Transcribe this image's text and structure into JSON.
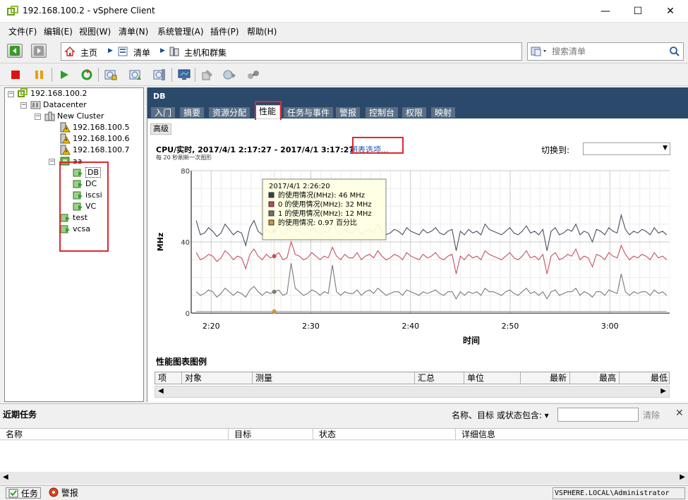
{
  "window": {
    "title": "192.168.100.2 - vSphere Client",
    "minimize_glyph": "—",
    "maximize_glyph": "☐",
    "close_glyph": "✕"
  },
  "menu": [
    "文件(F)",
    "编辑(E)",
    "视图(W)",
    "清单(N)",
    "系统管理(A)",
    "插件(P)",
    "帮助(H)"
  ],
  "breadcrumb": {
    "home": "主页",
    "inventory": "清单",
    "hosts_clusters": "主机和群集"
  },
  "search": {
    "placeholder": "搜索清单"
  },
  "tree": {
    "root": "192.168.100.2",
    "datacenter": "Datacenter",
    "cluster": "New Cluster",
    "hosts": [
      "192.168.100.5",
      "192.168.100.6",
      "192.168.100.7"
    ],
    "vapp": "aa",
    "vms": [
      "DB",
      "DC",
      "iscsi",
      "VC"
    ],
    "other_vms": [
      "test",
      "vcsa"
    ]
  },
  "object": {
    "title": "DB",
    "tabs": [
      "入门",
      "摘要",
      "资源分配",
      "性能",
      "任务与事件",
      "警报",
      "控制台",
      "权限",
      "映射"
    ],
    "active_tab": "性能",
    "subtab": "高级"
  },
  "chart_header": {
    "title": "CPU/实时, 2017/4/1 2:17:27 - 2017/4/1 3:17:27",
    "options_link": "图表选项...",
    "refresh_note": "每 20 秒刷新一次图形",
    "switch_label": "切换到:",
    "switch_value": ""
  },
  "tooltip": {
    "time": "2017/4/1 2:26:20",
    "lines": [
      {
        "text": "的使用情况(MHz): 46 MHz",
        "color": "#3a4050"
      },
      {
        "text": "0 的使用情况(MHz): 32 MHz",
        "color": "#b84a5a"
      },
      {
        "text": "1 的使用情况(MHz): 12 MHz",
        "color": "#707070"
      },
      {
        "text": "的使用情况: 0.97 百分比",
        "color": "#d8903a"
      }
    ]
  },
  "chart_data": {
    "type": "line",
    "ylabel": "MHz",
    "xlabel": "时间",
    "ylim": [
      0,
      80
    ],
    "yticks": [
      0,
      40,
      80
    ],
    "xticks": [
      "2:20",
      "2:30",
      "2:40",
      "2:50",
      "3:00"
    ],
    "xtick_minutes": [
      20,
      30,
      40,
      50,
      60
    ],
    "x_start_minute": 18,
    "x_end_minute": 66,
    "hover_minute": 26.33,
    "series": [
      {
        "color": "#4a5060",
        "values": [
          52,
          44,
          45,
          48,
          46,
          43,
          45,
          50,
          47,
          44,
          46,
          45,
          38,
          48,
          52,
          46,
          44,
          47,
          45,
          46,
          49,
          44,
          45,
          55,
          47,
          46,
          44,
          45,
          48,
          46,
          44,
          46,
          45,
          52,
          46,
          44,
          47,
          45,
          45,
          48,
          44,
          46,
          47,
          45,
          50,
          46,
          44,
          45,
          47,
          46,
          44,
          48,
          46,
          45,
          44,
          47,
          45,
          46,
          48,
          45,
          44,
          46,
          47,
          35,
          46,
          44,
          47,
          45,
          46,
          44,
          50,
          47,
          46,
          45,
          44,
          46,
          48,
          45,
          44,
          46,
          49,
          45,
          46,
          44,
          47,
          35,
          46,
          48,
          44,
          45,
          47,
          46,
          50,
          44,
          46,
          45,
          40,
          47,
          46,
          44,
          48,
          46,
          45,
          55,
          47,
          44,
          46,
          45,
          47,
          46,
          44,
          48,
          45,
          46,
          44
        ]
      },
      {
        "color": "#c8505f",
        "values": [
          34,
          30,
          31,
          33,
          32,
          29,
          31,
          35,
          33,
          30,
          32,
          31,
          25,
          33,
          36,
          32,
          30,
          33,
          31,
          32,
          34,
          30,
          31,
          40,
          33,
          32,
          30,
          31,
          34,
          32,
          30,
          32,
          31,
          37,
          32,
          30,
          33,
          31,
          31,
          34,
          30,
          32,
          33,
          31,
          35,
          32,
          30,
          31,
          33,
          32,
          30,
          34,
          32,
          31,
          30,
          33,
          31,
          32,
          34,
          31,
          30,
          32,
          33,
          22,
          32,
          30,
          33,
          31,
          32,
          30,
          35,
          33,
          32,
          31,
          30,
          32,
          34,
          31,
          30,
          32,
          35,
          31,
          32,
          30,
          33,
          22,
          32,
          34,
          30,
          31,
          33,
          32,
          36,
          30,
          32,
          31,
          26,
          33,
          32,
          30,
          34,
          32,
          31,
          38,
          33,
          30,
          32,
          31,
          33,
          32,
          30,
          34,
          31,
          32,
          30
        ]
      },
      {
        "color": "#7a7a7a",
        "values": [
          12,
          10,
          11,
          13,
          12,
          9,
          11,
          14,
          12,
          10,
          12,
          11,
          9,
          13,
          15,
          12,
          10,
          12,
          11,
          12,
          13,
          10,
          11,
          28,
          14,
          12,
          10,
          11,
          13,
          12,
          10,
          12,
          11,
          27,
          12,
          10,
          12,
          11,
          11,
          13,
          10,
          12,
          13,
          11,
          14,
          12,
          10,
          11,
          12,
          12,
          10,
          13,
          12,
          11,
          10,
          12,
          11,
          12,
          13,
          11,
          10,
          12,
          12,
          8,
          12,
          10,
          12,
          11,
          12,
          10,
          14,
          12,
          12,
          11,
          10,
          12,
          13,
          11,
          10,
          12,
          14,
          11,
          12,
          10,
          12,
          8,
          12,
          13,
          10,
          11,
          12,
          12,
          14,
          10,
          12,
          11,
          9,
          12,
          12,
          10,
          13,
          12,
          11,
          22,
          12,
          10,
          12,
          11,
          12,
          12,
          10,
          13,
          11,
          12,
          10
        ]
      },
      {
        "color": "#d8903a",
        "values": [
          1,
          1,
          1,
          1,
          1,
          1,
          1,
          1,
          1,
          1,
          1,
          1,
          1,
          1,
          1,
          1,
          1,
          1,
          1,
          1,
          1,
          1,
          1,
          1,
          1,
          1,
          1,
          1,
          1,
          1,
          1,
          1,
          1,
          1,
          1,
          1,
          1,
          1,
          1,
          1,
          1,
          1,
          1,
          1,
          1,
          1,
          1,
          1,
          1,
          1,
          1,
          1,
          1,
          1,
          1,
          1,
          1,
          1,
          1,
          1,
          1,
          1,
          1,
          1,
          1,
          1,
          1,
          1,
          1,
          1,
          1,
          1,
          1,
          1,
          1,
          1,
          1,
          1,
          1,
          1,
          1,
          1,
          1,
          1,
          1,
          1,
          1,
          1,
          1,
          1,
          1,
          1,
          1,
          1,
          1,
          1,
          1,
          1,
          1,
          1,
          1,
          1,
          1,
          1,
          1,
          1,
          1,
          1,
          1,
          1,
          1,
          1,
          1,
          1,
          1
        ]
      }
    ]
  },
  "legend": {
    "title": "性能图表图例",
    "columns": [
      "项",
      "对象",
      "测量",
      "汇总",
      "单位",
      "最新",
      "最高",
      "最低"
    ]
  },
  "tasks": {
    "title": "近期任务",
    "filter_label": "名称、目标 或状态包含: ▾",
    "filter_value": "",
    "clear": "清除",
    "close": "✕",
    "columns": [
      "名称",
      "目标",
      "状态",
      "详细信息"
    ]
  },
  "statusbar": {
    "tasks": "任务",
    "alarms": "警报",
    "user": "VSPHERE.LOCAL\\Administrator"
  }
}
